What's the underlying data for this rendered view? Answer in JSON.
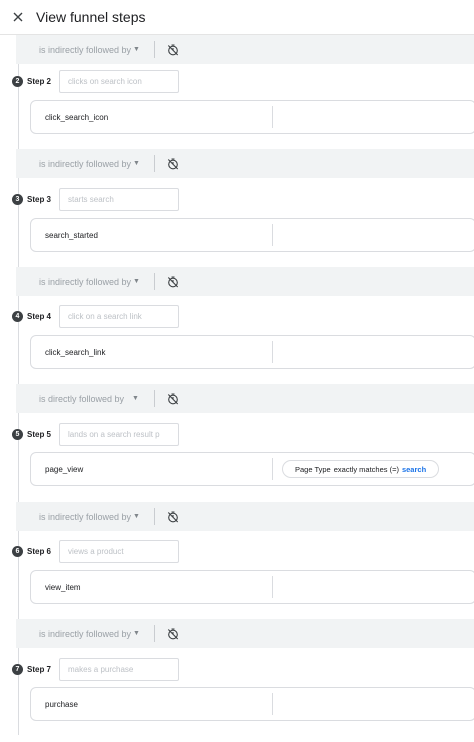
{
  "header": {
    "title": "View funnel steps",
    "close_icon": "close-icon"
  },
  "connectors": [
    {
      "label": "is indirectly followed by",
      "timer_icon": "timer-off-icon"
    },
    {
      "label": "is indirectly followed by",
      "timer_icon": "timer-off-icon"
    },
    {
      "label": "is indirectly followed by",
      "timer_icon": "timer-off-icon"
    },
    {
      "label": "is directly followed by",
      "timer_icon": "timer-off-icon"
    },
    {
      "label": "is indirectly followed by",
      "timer_icon": "timer-off-icon"
    },
    {
      "label": "is indirectly followed by",
      "timer_icon": "timer-off-icon"
    }
  ],
  "steps": [
    {
      "number": "2",
      "label": "Step 2",
      "placeholder": "clicks on search icon",
      "event": "click_search_icon"
    },
    {
      "number": "3",
      "label": "Step 3",
      "placeholder": "starts search",
      "event": "search_started"
    },
    {
      "number": "4",
      "label": "Step 4",
      "placeholder": "click on a search link",
      "event": "click_search_link"
    },
    {
      "number": "5",
      "label": "Step 5",
      "placeholder": "lands on a search result p",
      "event": "page_view",
      "param": {
        "name": "Page Type",
        "operator": "exactly matches (=)",
        "value": "search"
      }
    },
    {
      "number": "6",
      "label": "Step 6",
      "placeholder": "views a product",
      "event": "view_item"
    },
    {
      "number": "7",
      "label": "Step 7",
      "placeholder": "makes a purchase",
      "event": "purchase"
    }
  ]
}
